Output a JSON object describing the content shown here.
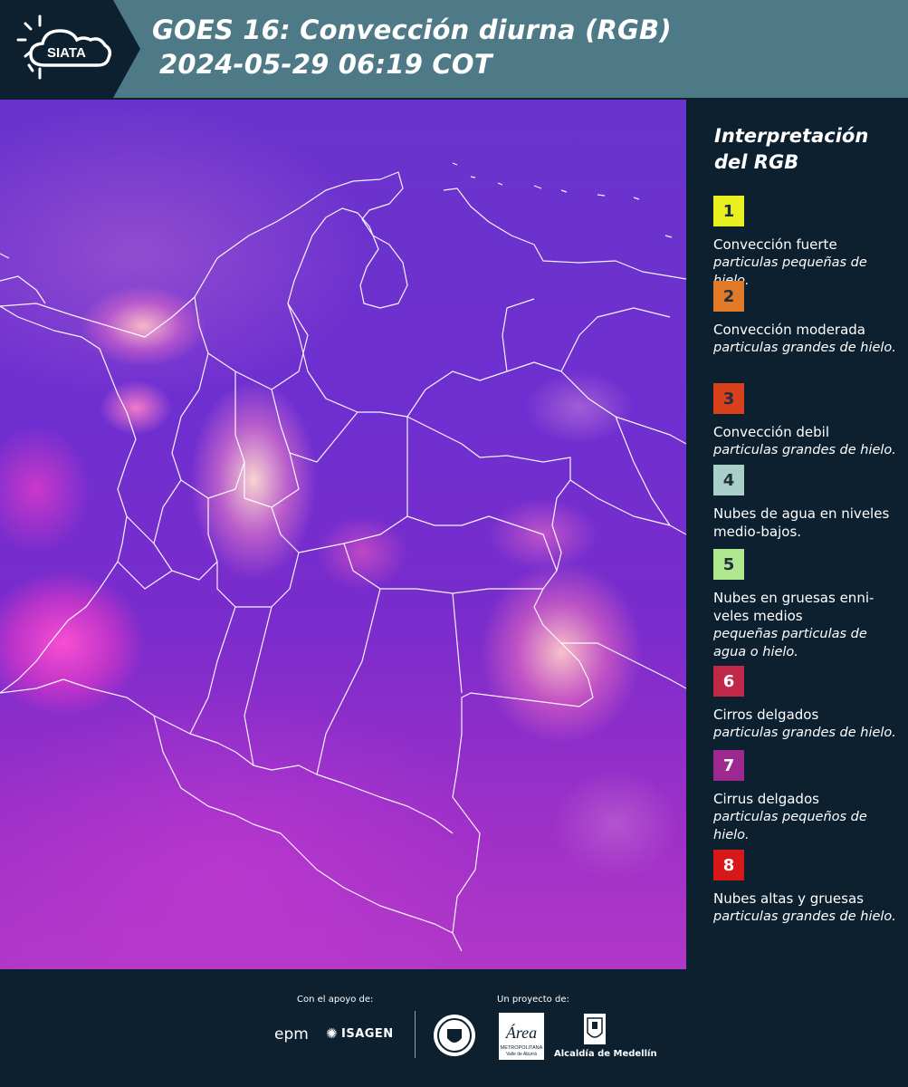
{
  "header": {
    "logo_text": "SIATA",
    "title_line1": "GOES 16: Convección diurna (RGB)",
    "title_line2": "2024-05-29 06:19 COT"
  },
  "legend": {
    "title_line1": "Interpretación",
    "title_line2": "del RGB",
    "items": [
      {
        "number": "1",
        "color": "#e8f020",
        "name": "Convección fuerte",
        "desc": "particulas pequeñas de hielo."
      },
      {
        "number": "2",
        "color": "#e07a28",
        "name": "Convección moderada",
        "desc": "particulas grandes de hielo."
      },
      {
        "number": "3",
        "color": "#d8401c",
        "name": "Convección debil",
        "desc": "particulas grandes de hielo."
      },
      {
        "number": "4",
        "color": "#a8d0c8",
        "name": "Nubes de agua en niveles medio-bajos.",
        "desc": ""
      },
      {
        "number": "5",
        "color": "#b0e890",
        "name": "Nubes en gruesas enni-veles medios",
        "desc": "pequeñas particulas de agua o hielo."
      },
      {
        "number": "6",
        "color": "#c02848",
        "name": "Cirros delgados",
        "desc": "particulas grandes de hielo."
      },
      {
        "number": "7",
        "color": "#9c2890",
        "name": "Cirrus delgados",
        "desc": "particulas pequeños de hielo."
      },
      {
        "number": "8",
        "color": "#d81818",
        "name": "Nubes altas y gruesas",
        "desc": "particulas grandes de hielo."
      }
    ]
  },
  "footer": {
    "support_label": "Con el apoyo de:",
    "project_label": "Un proyecto de:",
    "sponsor1": "epm",
    "sponsor2": "ISAGEN",
    "partner_area": "Área",
    "partner_area_sub1": "METROPOLITANA",
    "partner_area_sub2": "Valle de Aburrá",
    "partner_alcaldia": "Alcaldía de Medellín"
  }
}
